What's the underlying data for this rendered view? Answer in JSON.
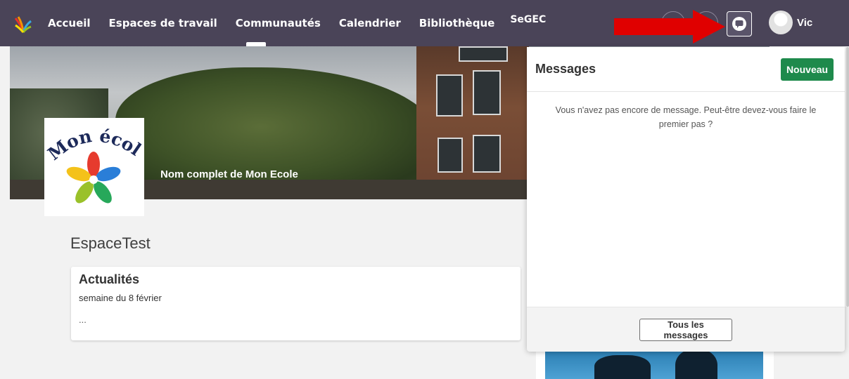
{
  "topbar": {
    "nav": [
      "Accueil",
      "Espaces de travail",
      "Communautés",
      "Calendrier",
      "Bibliothèque",
      "SeGEC"
    ],
    "username": "Vic",
    "active_nav": "Communautés"
  },
  "banner": {
    "school_logo_text": "Mon école",
    "title": "Nom complet de Mon Ecole"
  },
  "space": {
    "title": "EspaceTest"
  },
  "news": {
    "title": "Actualités",
    "subtitle": "semaine du 8 février",
    "ellipsis": "..."
  },
  "messages_panel": {
    "title": "Messages",
    "new_label": "Nouveau",
    "empty_text": "Vous n'avez pas encore de message. Peut-être devez-vous faire le premier pas ?",
    "all_label": "Tous les messages"
  },
  "colors": {
    "topbar": "#4a4458",
    "new_button": "#1e8a4c",
    "arrow": "#e00000"
  }
}
